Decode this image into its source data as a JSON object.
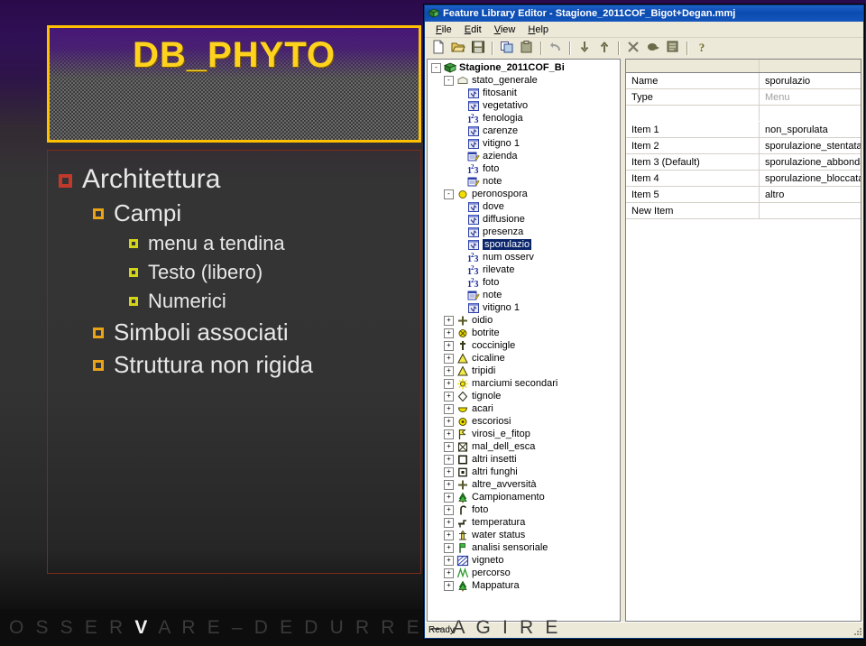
{
  "slide": {
    "title": "DB_PHYTO",
    "bullets": [
      {
        "level": 1,
        "text": "Architettura"
      },
      {
        "level": 2,
        "text": "Campi"
      },
      {
        "level": 3,
        "text": "menu a tendina"
      },
      {
        "level": 3,
        "text": "Testo (libero)"
      },
      {
        "level": 3,
        "text": "Numerici"
      },
      {
        "level": 2,
        "text": "Simboli associati"
      },
      {
        "level": 2,
        "text": "Struttura non rigida"
      }
    ],
    "footer_before": "O  S  S  E  R  ",
    "footer_highlight": "V",
    "footer_after": "  A  R  E  –  D  E  D  U  R  R  E  –  A  G  I  R  E",
    "colors": {
      "title_border": "#ffc000",
      "title_text": "#ffd21e",
      "bullet_l1": "#c0392b",
      "bullet_l2": "#e8a317",
      "bullet_l3": "#d4d417",
      "content_border": "#7d2b1a"
    }
  },
  "window": {
    "title": "Feature Library Editor - Stagione_2011COF_Bigot+Degan.mmj",
    "icon": "book-icon",
    "menus": [
      "File",
      "Edit",
      "View",
      "Help"
    ],
    "toolbar": [
      {
        "name": "new-icon",
        "label": "New"
      },
      {
        "name": "open-icon",
        "label": "Open"
      },
      {
        "name": "save-icon",
        "label": "Save"
      },
      {
        "name": "separator",
        "label": ""
      },
      {
        "name": "copy-icon",
        "label": "Copy"
      },
      {
        "name": "paste-icon",
        "label": "Paste"
      },
      {
        "name": "separator",
        "label": ""
      },
      {
        "name": "undo-icon",
        "label": "Undo"
      },
      {
        "name": "separator",
        "label": ""
      },
      {
        "name": "move-down-icon",
        "label": "Move Down"
      },
      {
        "name": "move-up-icon",
        "label": "Move Up"
      },
      {
        "name": "separator",
        "label": ""
      },
      {
        "name": "delete-icon",
        "label": "Delete"
      },
      {
        "name": "lock-icon",
        "label": "Lock"
      },
      {
        "name": "properties-icon",
        "label": "Properties"
      },
      {
        "name": "separator",
        "label": ""
      },
      {
        "name": "help-icon",
        "label": "Help"
      }
    ],
    "status": "Ready"
  },
  "tree": [
    {
      "depth": 0,
      "label": "Stagione_2011COF_Bi",
      "expander": "-",
      "icon": "book-green-icon",
      "bold": true,
      "selected": false
    },
    {
      "depth": 1,
      "label": "stato_generale",
      "expander": "-",
      "icon": "folder-small-icon",
      "bold": false,
      "selected": false
    },
    {
      "depth": 2,
      "label": "fitosanit",
      "expander": "",
      "icon": "menu-field-icon",
      "bold": false,
      "selected": false
    },
    {
      "depth": 2,
      "label": "vegetativo",
      "expander": "",
      "icon": "menu-field-icon",
      "bold": false,
      "selected": false
    },
    {
      "depth": 2,
      "label": "fenologia",
      "expander": "",
      "icon": "number-field-icon",
      "bold": false,
      "selected": false
    },
    {
      "depth": 2,
      "label": "carenze",
      "expander": "",
      "icon": "menu-field-icon",
      "bold": false,
      "selected": false
    },
    {
      "depth": 2,
      "label": "vitigno 1",
      "expander": "",
      "icon": "menu-field-icon",
      "bold": false,
      "selected": false
    },
    {
      "depth": 2,
      "label": "azienda",
      "expander": "",
      "icon": "text-field-icon",
      "bold": false,
      "selected": false
    },
    {
      "depth": 2,
      "label": "foto",
      "expander": "",
      "icon": "number-field-icon",
      "bold": false,
      "selected": false
    },
    {
      "depth": 2,
      "label": "note",
      "expander": "",
      "icon": "text-field-icon",
      "bold": false,
      "selected": false
    },
    {
      "depth": 1,
      "label": "peronospora",
      "expander": "-",
      "icon": "yellow-circle-icon",
      "bold": false,
      "selected": false
    },
    {
      "depth": 2,
      "label": "dove",
      "expander": "",
      "icon": "menu-field-icon",
      "bold": false,
      "selected": false
    },
    {
      "depth": 2,
      "label": "diffusione",
      "expander": "",
      "icon": "menu-field-icon",
      "bold": false,
      "selected": false
    },
    {
      "depth": 2,
      "label": "presenza",
      "expander": "",
      "icon": "menu-field-icon",
      "bold": false,
      "selected": false
    },
    {
      "depth": 2,
      "label": "sporulazio",
      "expander": "",
      "icon": "menu-field-icon",
      "bold": false,
      "selected": true
    },
    {
      "depth": 2,
      "label": "num osserv",
      "expander": "",
      "icon": "number-field-icon",
      "bold": false,
      "selected": false
    },
    {
      "depth": 2,
      "label": "rilevate",
      "expander": "",
      "icon": "number-field-icon",
      "bold": false,
      "selected": false
    },
    {
      "depth": 2,
      "label": "foto",
      "expander": "",
      "icon": "number-field-icon",
      "bold": false,
      "selected": false
    },
    {
      "depth": 2,
      "label": "note",
      "expander": "",
      "icon": "text-field-icon",
      "bold": false,
      "selected": false
    },
    {
      "depth": 2,
      "label": "vitigno 1",
      "expander": "",
      "icon": "menu-field-icon",
      "bold": false,
      "selected": false
    },
    {
      "depth": 1,
      "label": "oidio",
      "expander": "+",
      "icon": "cross-plus-icon",
      "bold": false,
      "selected": false
    },
    {
      "depth": 1,
      "label": "botrite",
      "expander": "+",
      "icon": "circle-x-icon",
      "bold": false,
      "selected": false
    },
    {
      "depth": 1,
      "label": "coccinigle",
      "expander": "+",
      "icon": "dagger-icon",
      "bold": false,
      "selected": false
    },
    {
      "depth": 1,
      "label": "cicaline",
      "expander": "+",
      "icon": "triangle-yellow-icon",
      "bold": false,
      "selected": false
    },
    {
      "depth": 1,
      "label": "tripidi",
      "expander": "+",
      "icon": "triangle-yellow-icon",
      "bold": false,
      "selected": false
    },
    {
      "depth": 1,
      "label": "marciumi secondari",
      "expander": "+",
      "icon": "sun-icon",
      "bold": false,
      "selected": false
    },
    {
      "depth": 1,
      "label": "tignole",
      "expander": "+",
      "icon": "diamond-icon",
      "bold": false,
      "selected": false
    },
    {
      "depth": 1,
      "label": "acari",
      "expander": "+",
      "icon": "half-circle-icon",
      "bold": false,
      "selected": false
    },
    {
      "depth": 1,
      "label": "escoriosi",
      "expander": "+",
      "icon": "target-circle-icon",
      "bold": false,
      "selected": false
    },
    {
      "depth": 1,
      "label": "virosi_e_fitop",
      "expander": "+",
      "icon": "flag-icon",
      "bold": false,
      "selected": false
    },
    {
      "depth": 1,
      "label": "mal_dell_esca",
      "expander": "+",
      "icon": "box-cross-icon",
      "bold": false,
      "selected": false
    },
    {
      "depth": 1,
      "label": "altri insetti",
      "expander": "+",
      "icon": "square-outline-icon",
      "bold": false,
      "selected": false
    },
    {
      "depth": 1,
      "label": "altri funghi",
      "expander": "+",
      "icon": "square-dot-icon",
      "bold": false,
      "selected": false
    },
    {
      "depth": 1,
      "label": "altre_avversità",
      "expander": "+",
      "icon": "cross-plus-icon",
      "bold": false,
      "selected": false
    },
    {
      "depth": 1,
      "label": "Campionamento",
      "expander": "+",
      "icon": "tree-green-icon",
      "bold": false,
      "selected": false
    },
    {
      "depth": 1,
      "label": "foto",
      "expander": "+",
      "icon": "hook-icon",
      "bold": false,
      "selected": false
    },
    {
      "depth": 1,
      "label": "temperatura",
      "expander": "+",
      "icon": "tap-icon",
      "bold": false,
      "selected": false
    },
    {
      "depth": 1,
      "label": "water status",
      "expander": "+",
      "icon": "hydrant-icon",
      "bold": false,
      "selected": false
    },
    {
      "depth": 1,
      "label": "analisi sensoriale",
      "expander": "+",
      "icon": "flag-green-icon",
      "bold": false,
      "selected": false
    },
    {
      "depth": 1,
      "label": "vigneto",
      "expander": "+",
      "icon": "hatched-square-icon",
      "bold": false,
      "selected": false
    },
    {
      "depth": 1,
      "label": "percorso",
      "expander": "+",
      "icon": "zigzag-line-icon",
      "bold": false,
      "selected": false
    },
    {
      "depth": 1,
      "label": "Mappatura",
      "expander": "+",
      "icon": "tree-green-icon",
      "bold": false,
      "selected": false
    }
  ],
  "properties": {
    "rows": [
      {
        "key": "Name",
        "value": "sporulazio",
        "gray": false,
        "blank": false
      },
      {
        "key": "Type",
        "value": "Menu",
        "gray": true,
        "blank": false
      },
      {
        "key": "",
        "value": "",
        "gray": false,
        "blank": true
      },
      {
        "key": "Item 1",
        "value": "non_sporulata",
        "gray": false,
        "blank": false
      },
      {
        "key": "Item 2",
        "value": "sporulazione_stentata",
        "gray": false,
        "blank": false
      },
      {
        "key": "Item 3  (Default)",
        "value": "sporulazione_abbondante",
        "gray": false,
        "blank": false
      },
      {
        "key": "Item 4",
        "value": "sporulazione_bloccata",
        "gray": false,
        "blank": false
      },
      {
        "key": "Item 5",
        "value": "altro",
        "gray": false,
        "blank": false
      },
      {
        "key": "New Item",
        "value": "",
        "gray": false,
        "blank": false
      }
    ]
  }
}
